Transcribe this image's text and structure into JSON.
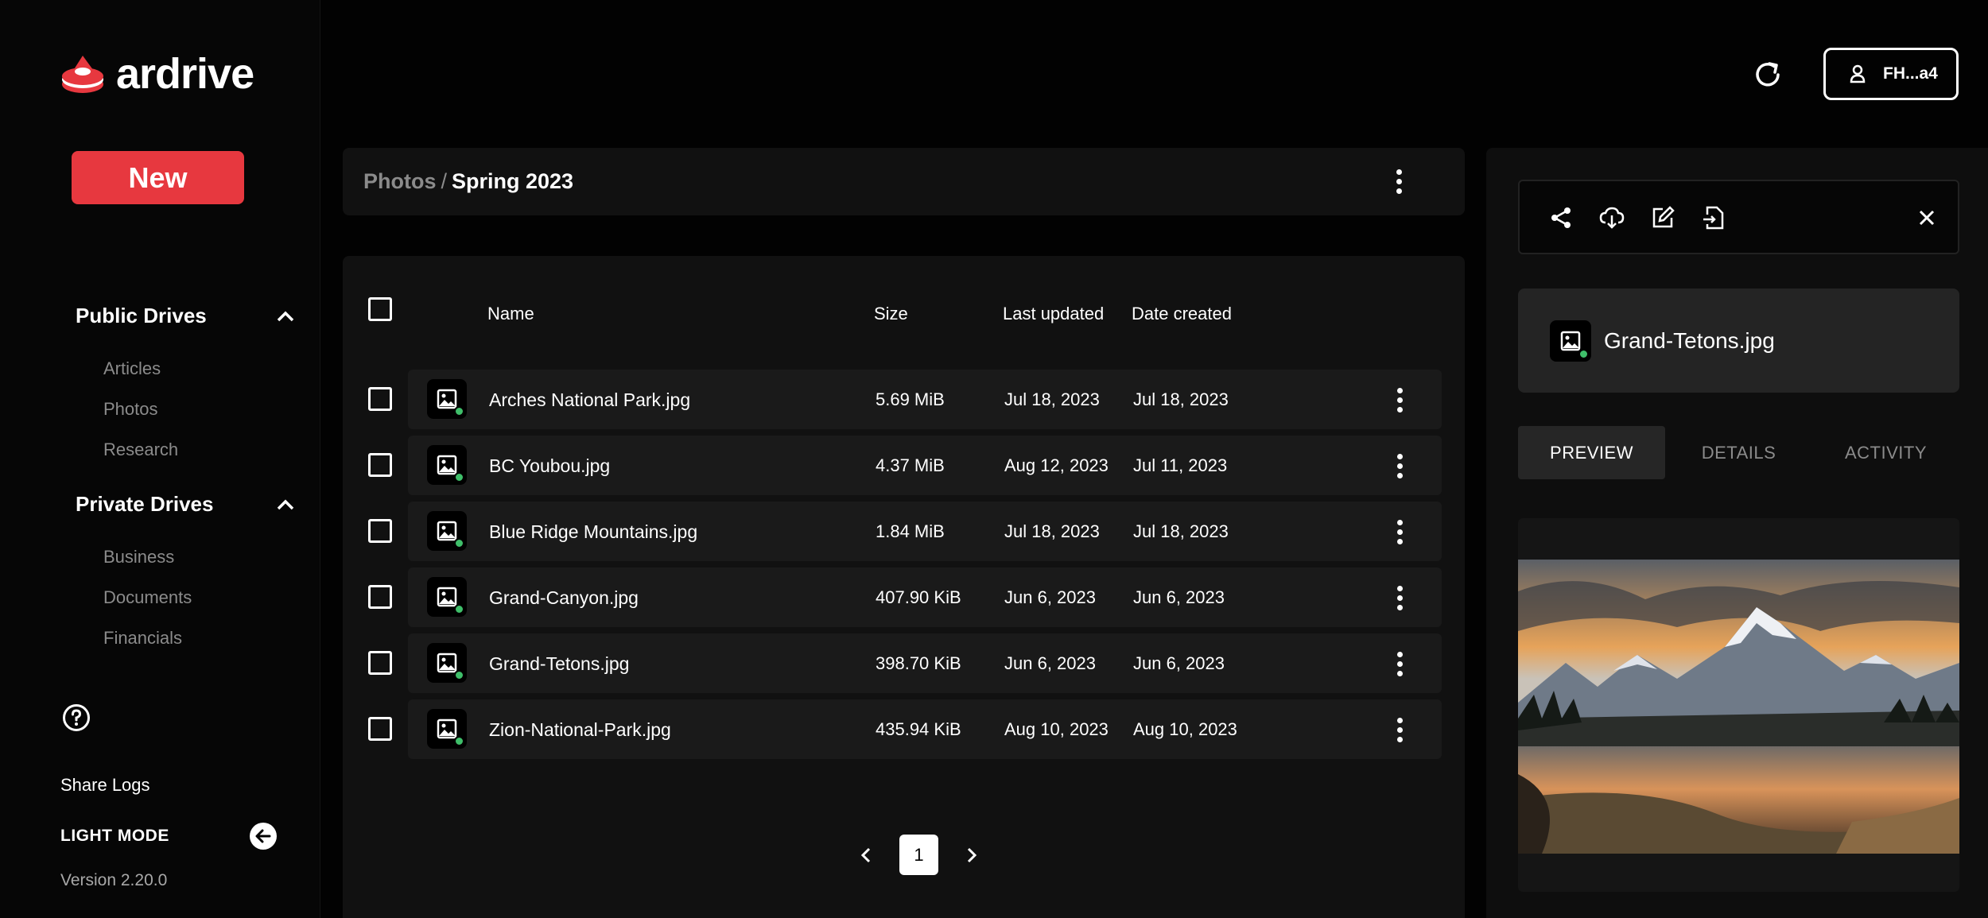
{
  "app": {
    "logo_text": "ardrive",
    "new_button": "New"
  },
  "sidebar": {
    "public_drives": {
      "label": "Public Drives",
      "items": [
        "Articles",
        "Photos",
        "Research"
      ]
    },
    "private_drives": {
      "label": "Private Drives",
      "items": [
        "Business",
        "Documents",
        "Financials"
      ]
    },
    "share_logs": "Share Logs",
    "light_mode": "LIGHT MODE",
    "version": "Version 2.20.0"
  },
  "topbar": {
    "profile_label": "FH...a4"
  },
  "breadcrumb": {
    "parent": "Photos",
    "separator": "/",
    "current": "Spring 2023"
  },
  "table": {
    "columns": {
      "name": "Name",
      "size": "Size",
      "last_updated": "Last updated",
      "date_created": "Date created"
    },
    "rows": [
      {
        "name": "Arches National Park.jpg",
        "size": "5.69 MiB",
        "last_updated": "Jul 18, 2023",
        "date_created": "Jul 18, 2023"
      },
      {
        "name": "BC Youbou.jpg",
        "size": "4.37 MiB",
        "last_updated": "Aug 12, 2023",
        "date_created": "Jul 11, 2023"
      },
      {
        "name": "Blue Ridge Mountains.jpg",
        "size": "1.84 MiB",
        "last_updated": "Jul 18, 2023",
        "date_created": "Jul 18, 2023"
      },
      {
        "name": "Grand-Canyon.jpg",
        "size": "407.90 KiB",
        "last_updated": "Jun 6, 2023",
        "date_created": "Jun 6, 2023"
      },
      {
        "name": "Grand-Tetons.jpg",
        "size": "398.70 KiB",
        "last_updated": "Jun 6, 2023",
        "date_created": "Jun 6, 2023"
      },
      {
        "name": "Zion-National-Park.jpg",
        "size": "435.94 KiB",
        "last_updated": "Aug 10, 2023",
        "date_created": "Aug 10, 2023"
      }
    ],
    "pagination": {
      "current_page": "1"
    }
  },
  "detail": {
    "file_name": "Grand-Tetons.jpg",
    "tabs": [
      "PREVIEW",
      "DETAILS",
      "ACTIVITY"
    ],
    "active_tab": "PREVIEW"
  },
  "colors": {
    "accent": "#e7383f",
    "background": "#020202",
    "panel": "#111111",
    "status_synced": "#3fbf6a"
  }
}
